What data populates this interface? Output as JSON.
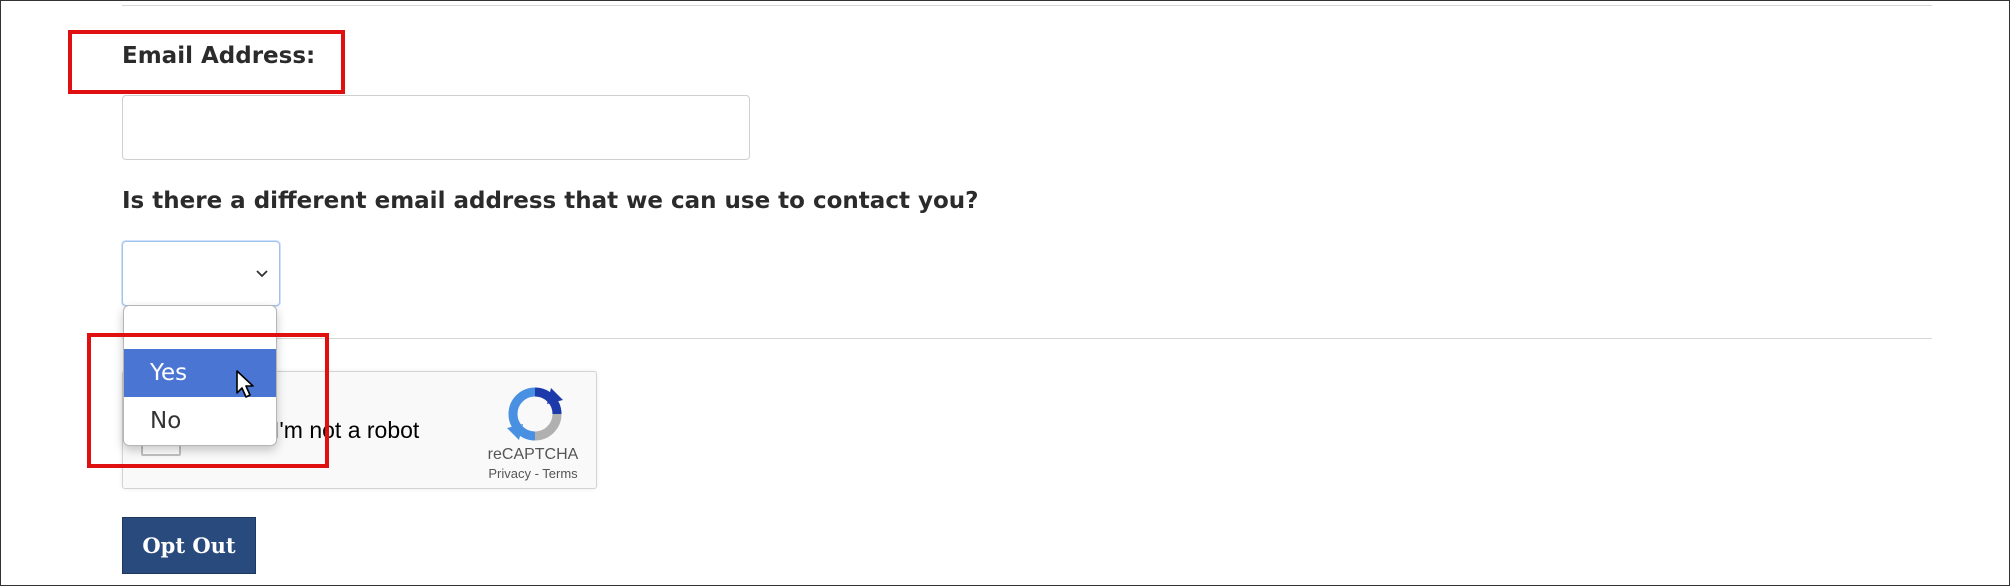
{
  "form": {
    "email_label": "Email Address:",
    "email_value": "",
    "different_email_question": "Is there a different email address that we can use to contact you?",
    "contact_select_value": "",
    "contact_options": [
      "",
      "Yes",
      "No"
    ],
    "highlighted_option": "Yes"
  },
  "recaptcha": {
    "checkbox_label": "I'm not a robot",
    "brand": "reCAPTCHA",
    "privacy_link": "Privacy",
    "separator": " - ",
    "terms_link": "Terms"
  },
  "actions": {
    "opt_out_label": "Opt Out"
  },
  "colors": {
    "highlight_red": "#e01010",
    "selected_option": "#4a75d3",
    "button_bg": "#284a7c"
  },
  "icons": {
    "select_chevron": "chevron-down-icon",
    "recaptcha_logo": "recaptcha-logo-icon",
    "cursor": "mouse-pointer-icon"
  }
}
